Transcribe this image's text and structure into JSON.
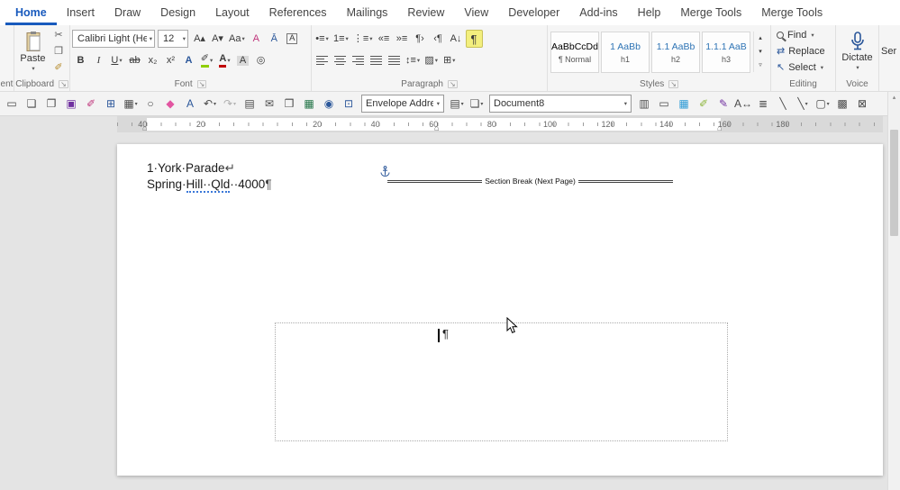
{
  "ui": {
    "caret": "▾",
    "launcher": "↘",
    "scroll_up": "▴"
  },
  "colors": {
    "accent": "#185abd",
    "marks_highlight": "#f3ef7e",
    "grammar_underline": "#3b78d8",
    "dictate_icon": "#2b579a"
  },
  "tabs": [
    {
      "name": "tab-home",
      "label": "Home",
      "cls": "active"
    },
    {
      "name": "tab-insert",
      "label": "Insert"
    },
    {
      "name": "tab-draw",
      "label": "Draw"
    },
    {
      "name": "tab-design",
      "label": "Design"
    },
    {
      "name": "tab-layout",
      "label": "Layout"
    },
    {
      "name": "tab-references",
      "label": "References"
    },
    {
      "name": "tab-mailings",
      "label": "Mailings"
    },
    {
      "name": "tab-review",
      "label": "Review"
    },
    {
      "name": "tab-view",
      "label": "View"
    },
    {
      "name": "tab-developer",
      "label": "Developer"
    },
    {
      "name": "tab-add-ins",
      "label": "Add-ins"
    },
    {
      "name": "tab-help",
      "label": "Help"
    },
    {
      "name": "tab-merge-tools-1",
      "label": "Merge Tools"
    },
    {
      "name": "tab-merge-tools-2",
      "label": "Merge Tools"
    }
  ],
  "ribbon": {
    "partial_left_label": "ent",
    "clipboard": {
      "paste_label": "Paste",
      "group_label": "Clipboard",
      "side": [
        {
          "name": "cut-button",
          "glyph": "✂",
          "color": "#5a5a5a"
        },
        {
          "name": "copy-button",
          "glyph": "❐",
          "color": "#5a5a5a"
        },
        {
          "name": "format-painter-button",
          "glyph": "✐",
          "color": "#b58a2a"
        }
      ]
    },
    "font": {
      "font_name": "Calibri Light (Heac",
      "font_size": "12",
      "group_label": "Font",
      "row1": [
        {
          "name": "grow-font-button",
          "glyph": "A▴"
        },
        {
          "name": "shrink-font-button",
          "glyph": "A▾"
        },
        {
          "name": "change-case-button",
          "glyph": "Aa",
          "caret": true
        },
        {
          "name": "clear-formatting-button",
          "glyph": "A",
          "color": "#c0367c"
        },
        {
          "name": "phonetic-guide-button",
          "glyph": "Ā",
          "color": "#2b579a"
        },
        {
          "name": "character-border-button",
          "glyph": "A",
          "cls": "boxed"
        }
      ],
      "row2": [
        {
          "name": "bold-button",
          "glyph": "B",
          "cls": "bold"
        },
        {
          "name": "italic-button",
          "glyph": "I",
          "cls": "italic"
        },
        {
          "name": "underline-button",
          "glyph": "U",
          "cls": "underline",
          "caret": true
        },
        {
          "name": "strikethrough-button",
          "glyph": "ab",
          "cls": "strike"
        },
        {
          "name": "subscript-button",
          "glyph": "x₂"
        },
        {
          "name": "superscript-button",
          "glyph": "x²"
        },
        {
          "name": "text-effects-button",
          "glyph": "A",
          "cls": "effects"
        },
        {
          "name": "highlight-color-button",
          "glyph": "✐",
          "cls": "bar-green",
          "caret": true
        },
        {
          "name": "font-color-button",
          "glyph": "A",
          "cls": "bar-red",
          "caret": true
        },
        {
          "name": "character-shading-button",
          "glyph": "A",
          "cls": "shaded"
        },
        {
          "name": "enclose-characters-button",
          "glyph": "◎"
        }
      ]
    },
    "paragraph": {
      "group_label": "Paragraph",
      "row1": [
        {
          "name": "bullets-button",
          "glyph": "•≡",
          "caret": true
        },
        {
          "name": "numbering-button",
          "glyph": "1≡",
          "caret": true
        },
        {
          "name": "multilevel-list-button",
          "glyph": "⋮≡",
          "caret": true
        },
        {
          "name": "decrease-indent-button",
          "glyph": "«≡"
        },
        {
          "name": "increase-indent-button",
          "glyph": "»≡"
        },
        {
          "name": "left-to-right-button",
          "glyph": "¶›"
        },
        {
          "name": "right-to-left-button",
          "glyph": "‹¶"
        },
        {
          "name": "sort-button",
          "glyph": "A↓"
        },
        {
          "name": "show-formatting-marks-button",
          "glyph": "¶",
          "cls": "hl"
        }
      ],
      "row2": [
        {
          "name": "align-left-button",
          "cls": "lines-left"
        },
        {
          "name": "align-center-button",
          "cls": "lines-center"
        },
        {
          "name": "align-right-button",
          "cls": "lines-right"
        },
        {
          "name": "justify-button",
          "cls": "lines-justify"
        },
        {
          "name": "distribute-button",
          "cls": "lines-justify"
        },
        {
          "name": "line-spacing-button",
          "glyph": "↕≡",
          "caret": true
        },
        {
          "name": "shading-button",
          "glyph": "▨",
          "caret": true
        },
        {
          "name": "borders-button",
          "glyph": "⊞",
          "caret": true
        }
      ]
    },
    "styles": {
      "group_label": "Styles",
      "tiles": [
        {
          "name": "style-normal",
          "preview": "AaBbCcDd",
          "name_label": "¶ Normal"
        },
        {
          "name": "style-h1",
          "preview": "1 AaBb",
          "name_label": "h1",
          "cls": "blue"
        },
        {
          "name": "style-h2",
          "preview": "1.1 AaBb",
          "name_label": "h2",
          "cls": "blue"
        },
        {
          "name": "style-h3",
          "preview": "1.1.1 AaB",
          "name_label": "h3",
          "cls": "blue"
        }
      ],
      "arrows": [
        {
          "name": "styles-up-button",
          "glyph": "▴"
        },
        {
          "name": "styles-down-button",
          "glyph": "▾"
        },
        {
          "name": "styles-gallery-button",
          "glyph": "▿"
        }
      ]
    },
    "editing": {
      "group_label": "Editing",
      "items": [
        {
          "name": "find-button",
          "label": "Find",
          "glyph": "",
          "cls": "mag",
          "caret": true
        },
        {
          "name": "replace-button",
          "label": "Replace",
          "glyph": "⇄"
        },
        {
          "name": "select-button",
          "label": "Select",
          "glyph": "↖",
          "caret": true
        }
      ]
    },
    "voice": {
      "group_label": "Voice",
      "dictate_label": "Dictate"
    },
    "sensitivity": {
      "partial_label": "Ser"
    }
  },
  "toolbar": {
    "icons_a": [
      {
        "name": "text-frame-icon",
        "glyph": "▭"
      },
      {
        "name": "new-document-icon",
        "glyph": "❏"
      },
      {
        "name": "copy-page-icon",
        "glyph": "❐"
      },
      {
        "name": "save-icon",
        "glyph": "▣",
        "color": "#7030a0"
      },
      {
        "name": "format-brush-icon",
        "glyph": "✐",
        "color": "#c0367c"
      },
      {
        "name": "org-chart-icon",
        "glyph": "⊞",
        "color": "#2b579a"
      },
      {
        "name": "insert-table-icon",
        "glyph": "▦",
        "caret": true
      },
      {
        "name": "zoom-icon",
        "glyph": "○"
      },
      {
        "name": "eraser-icon",
        "glyph": "◆",
        "color": "#e255a1"
      },
      {
        "name": "font-effects-icon",
        "glyph": "A",
        "color": "#2b579a"
      },
      {
        "name": "undo-icon",
        "glyph": "↶",
        "caret": true
      },
      {
        "name": "redo-icon",
        "glyph": "↷",
        "caret": true,
        "cls": "disabled"
      },
      {
        "name": "page-margins-icon",
        "glyph": "▤"
      },
      {
        "name": "envelope-icon",
        "glyph": "✉"
      },
      {
        "name": "pages-icon",
        "glyph": "❒"
      },
      {
        "name": "table-green-icon",
        "glyph": "▦",
        "color": "#217346"
      },
      {
        "name": "record-icon",
        "glyph": "◉",
        "color": "#2b579a"
      },
      {
        "name": "field-shading-icon",
        "glyph": "⊡",
        "color": "#2b579a"
      }
    ],
    "style_combo": "Envelope Addres",
    "icons_b": [
      {
        "name": "envelope-feed-icon",
        "glyph": "▤",
        "caret": true
      },
      {
        "name": "insert-page-icon",
        "glyph": "❏",
        "caret": true
      }
    ],
    "doc_combo": "Document8",
    "icons_c": [
      {
        "name": "two-pages-icon",
        "glyph": "▥"
      },
      {
        "name": "page-width-icon",
        "glyph": "▭"
      },
      {
        "name": "grid-icon",
        "glyph": "▦",
        "color": "#2e9bd6"
      },
      {
        "name": "highlighter-icon",
        "glyph": "✐",
        "color": "#8db63c"
      },
      {
        "name": "pen-icon",
        "glyph": "✎",
        "color": "#7030a0"
      },
      {
        "name": "fit-text-icon",
        "glyph": "A↔"
      },
      {
        "name": "list-icon",
        "glyph": "≣"
      },
      {
        "name": "line-icon",
        "glyph": "╲"
      },
      {
        "name": "draw-line-icon",
        "glyph": "╲",
        "caret": true
      },
      {
        "name": "text-box-icon",
        "glyph": "▢",
        "caret": true
      },
      {
        "name": "barcode-icon",
        "glyph": "▩"
      },
      {
        "name": "cancel-icon",
        "glyph": "⊠"
      }
    ]
  },
  "ruler": {
    "numbers": [
      "40",
      "20",
      "",
      "20",
      "40",
      "60",
      "80",
      "100",
      "120",
      "140",
      "160",
      "180"
    ]
  },
  "document": {
    "line1": "1·York·Parade",
    "line1_mark": "↵",
    "line2_pre": "Spring·",
    "line2_flagged": "Hill··Qld",
    "line2_post": "··4000",
    "pilcrow": "¶",
    "section_break_label": "Section Break (Next Page)",
    "frame_pilcrow": "¶"
  }
}
